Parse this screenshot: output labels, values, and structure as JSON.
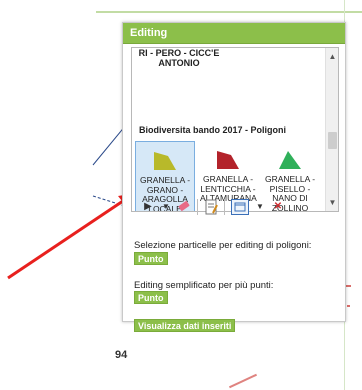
{
  "panel": {
    "title": "Editing",
    "prev_item": "RI - PERO - CICC'E ANTONIO",
    "group_title": "Biodiversita bando 2017 - Poligoni",
    "templates": [
      {
        "label": "GRANELLA - GRANO - ARAGOLLA LOCALE",
        "color": "#b8b92a",
        "selected": true
      },
      {
        "label": "GRANELLA - LENTICCHIA - ALTAMURANA",
        "color": "#b3232b",
        "selected": false
      },
      {
        "label": "GRANELLA - PISELLO - NANO DI ZOLLINO",
        "color": "#2fb05a",
        "selected": false
      }
    ],
    "toolbar": {
      "select_icon": "arrow-icon",
      "eraser_icon": "eraser-icon",
      "edit_icon": "attributes-icon",
      "window_icon": "window-select-icon",
      "delete_icon": "delete-icon"
    }
  },
  "sections": {
    "polygon_label": "Selezione particelle per editing di poligoni:",
    "polygon_button": "Punto",
    "points_label": "Editing semplificato per più punti:",
    "points_button": "Punto",
    "view_button": "Visualizza dati inseriti"
  },
  "background": {
    "number_fragment": "94"
  },
  "colors": {
    "accent_green": "#8cbf4a",
    "arrow_red": "#e8201e"
  }
}
